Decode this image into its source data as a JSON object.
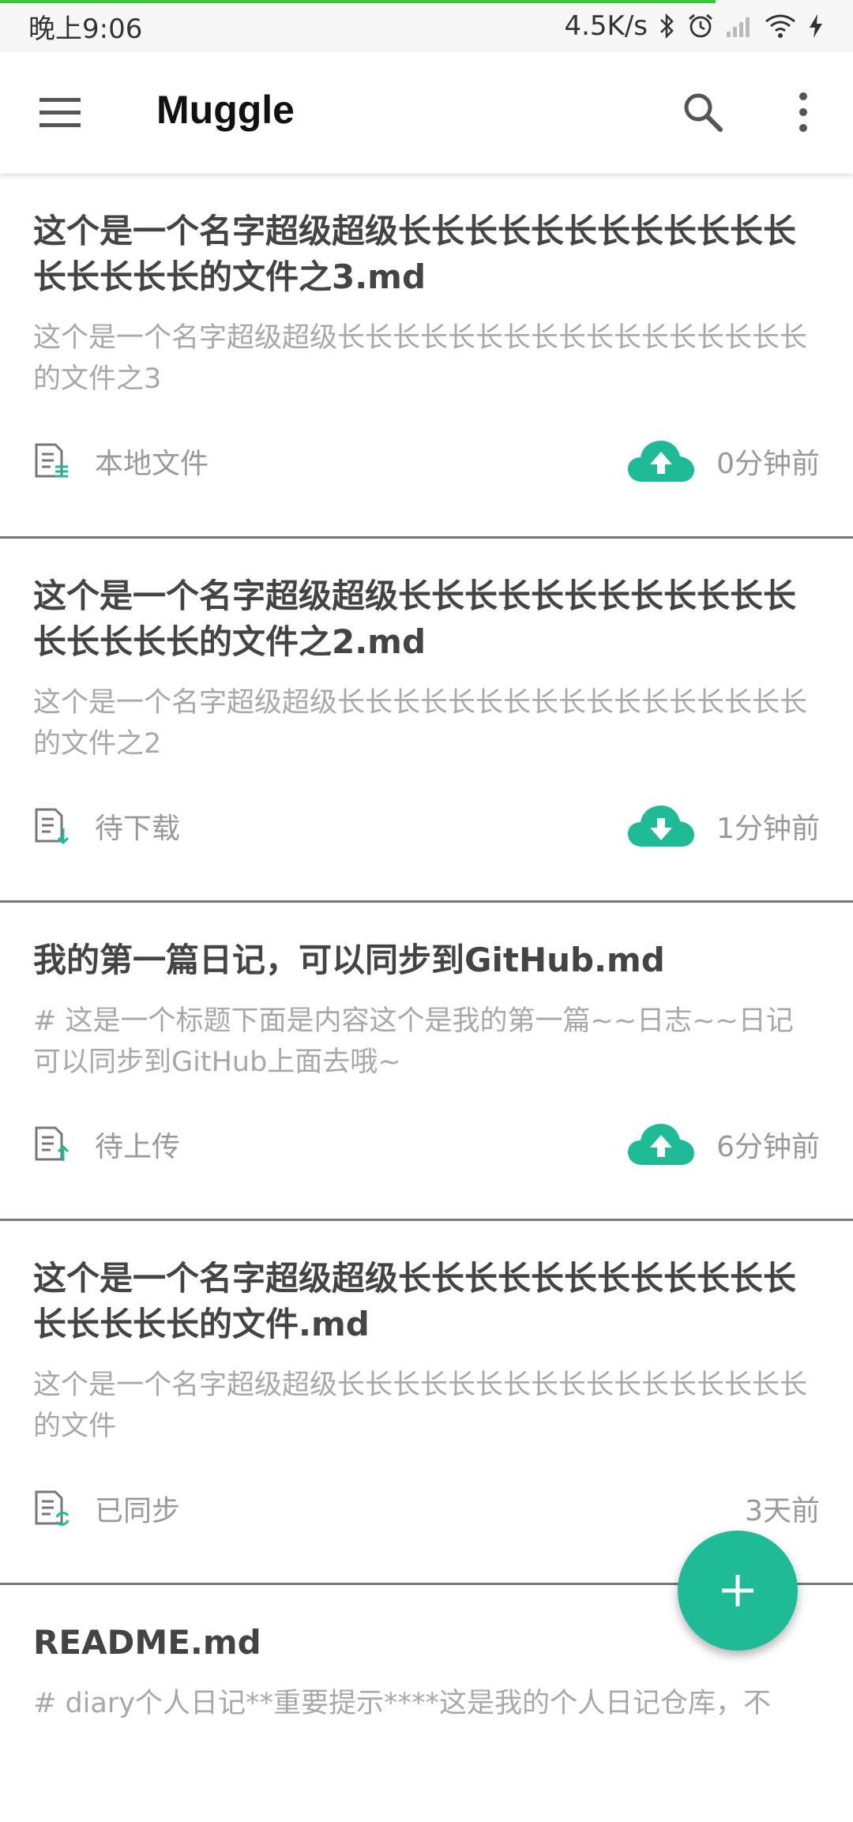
{
  "status_bar": {
    "time": "晚上9:06",
    "network_speed": "4.5K/s",
    "icons": [
      "bluetooth-icon",
      "alarm-icon",
      "signal-icon",
      "wifi-icon",
      "charging-icon"
    ]
  },
  "app_bar": {
    "title": "Muggle",
    "icons": [
      "menu-icon",
      "search-icon",
      "more-vert-icon"
    ]
  },
  "colors": {
    "accent": "#1fba96",
    "progress": "#3ac53a"
  },
  "files": [
    {
      "title": "这个是一个名字超级超级长长长长长长长长长长长长长长长长长的文件之3.md",
      "preview": "这个是一个名字超级超级长长长长长长长长长长长长长长长长长的文件之3",
      "status": "本地文件",
      "status_icon": "local-file-icon",
      "cloud_icon": "cloud-upload-icon",
      "time": "0分钟前"
    },
    {
      "title": "这个是一个名字超级超级长长长长长长长长长长长长长长长长长的文件之2.md",
      "preview": "这个是一个名字超级超级长长长长长长长长长长长长长长长长长的文件之2",
      "status": "待下载",
      "status_icon": "pending-download-file-icon",
      "cloud_icon": "cloud-download-icon",
      "time": "1分钟前"
    },
    {
      "title": "我的第一篇日记，可以同步到GitHub.md",
      "preview": "# 这是一个标题下面是内容这个是我的第一篇~~日志~~日记可以同步到GitHub上面去哦~",
      "status": "待上传",
      "status_icon": "pending-upload-file-icon",
      "cloud_icon": "cloud-upload-icon",
      "time": "6分钟前"
    },
    {
      "title": "这个是一个名字超级超级长长长长长长长长长长长长长长长长长的文件.md",
      "preview": "这个是一个名字超级超级长长长长长长长长长长长长长长长长长的文件",
      "status": "已同步",
      "status_icon": "synced-file-icon",
      "cloud_icon": "",
      "time": "3天前"
    },
    {
      "title": "README.md",
      "preview": "# diary个人日记**重要提示****这是我的个人日记仓库，不",
      "status": "",
      "status_icon": "",
      "cloud_icon": "",
      "time": ""
    }
  ],
  "fab": {
    "icon": "add-icon"
  }
}
